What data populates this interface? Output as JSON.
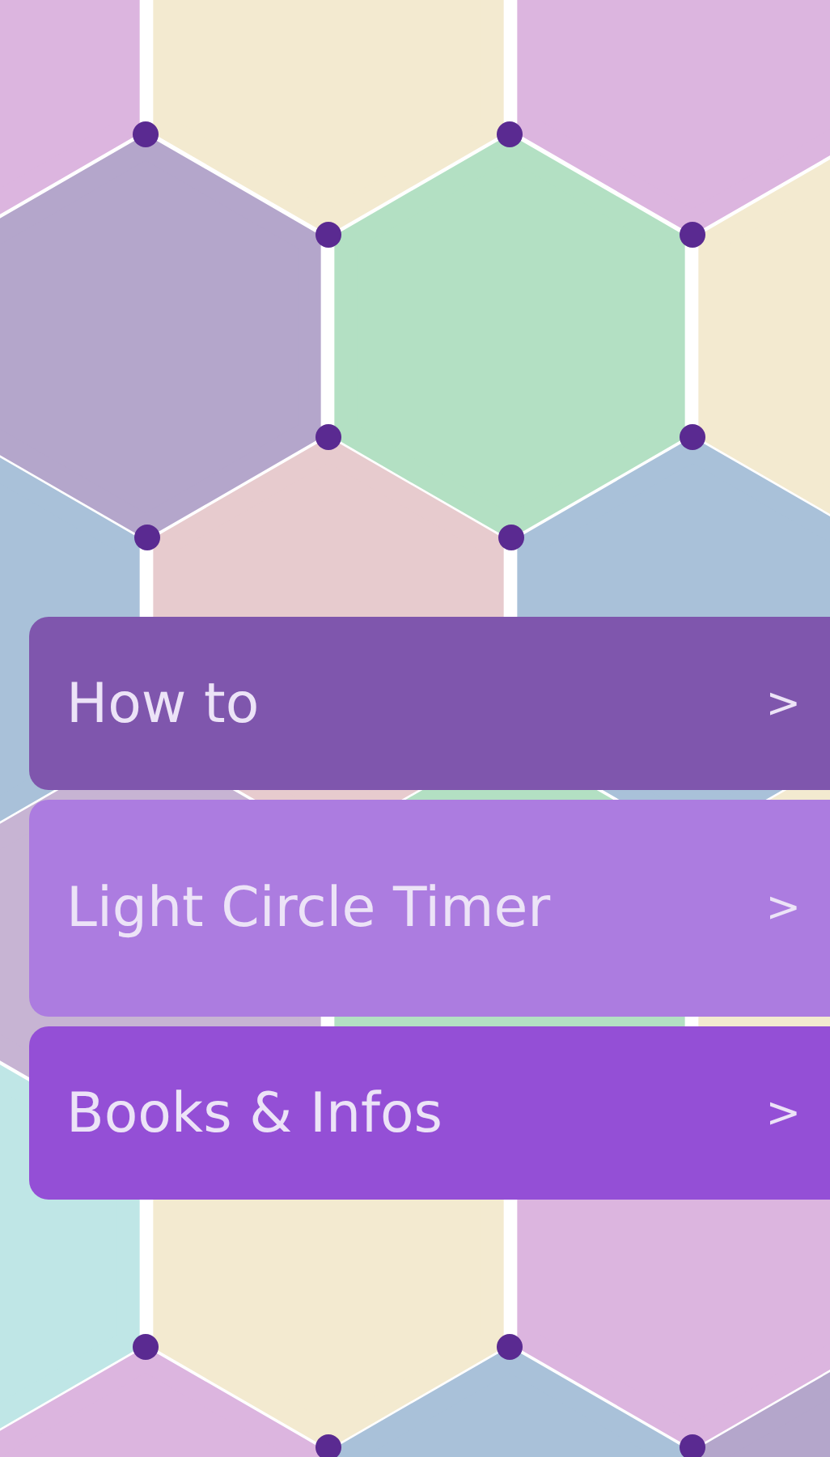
{
  "menu": [
    {
      "label": "How to",
      "arrow": ">",
      "color": "#7f56ad"
    },
    {
      "label": "Light Circle Timer",
      "arrow": ">",
      "color": "#ac7ce0"
    },
    {
      "label": "Books & Infos",
      "arrow": ">",
      "color": "#944fd6"
    }
  ]
}
